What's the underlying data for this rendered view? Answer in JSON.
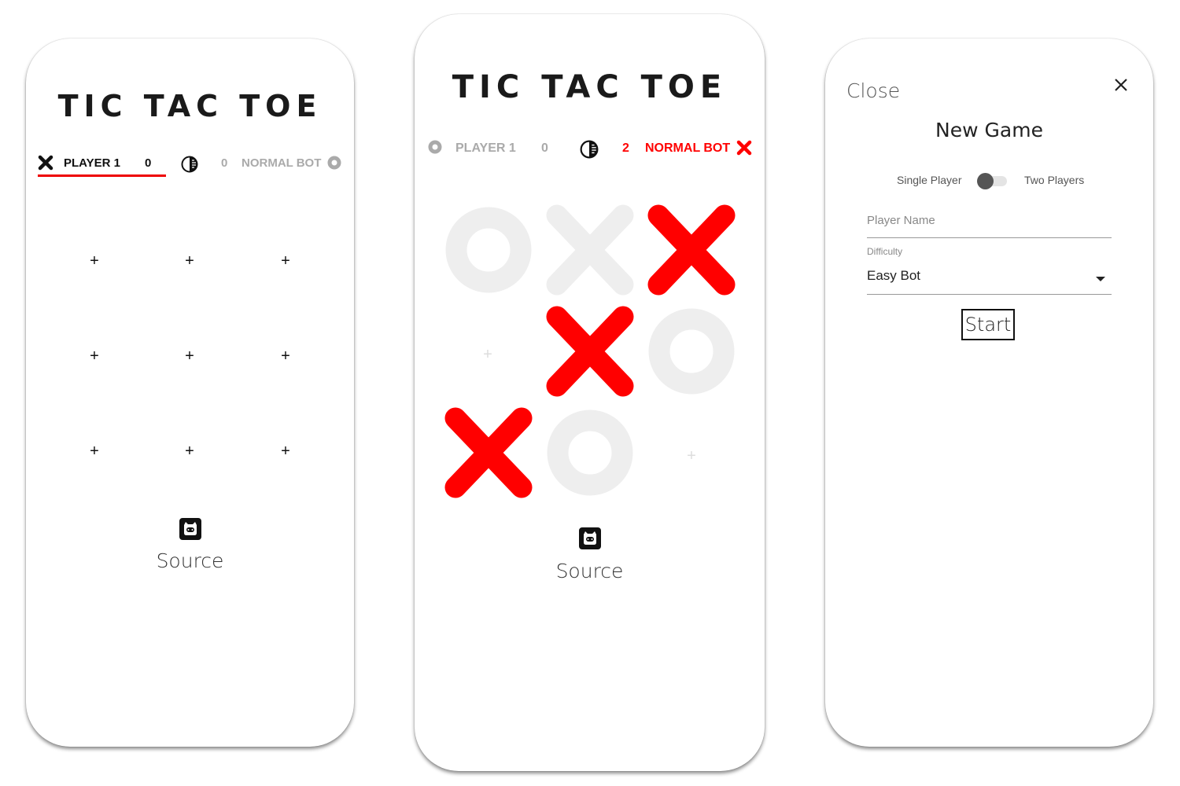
{
  "colors": {
    "accent": "#ff0000",
    "text": "#1a1a1a",
    "muted": "#aaaaaa",
    "ghost": "#eeeeee"
  },
  "left": {
    "title": "TIC TAC TOE",
    "player": {
      "mark": "x-icon",
      "name": "PLAYER 1",
      "score": "0"
    },
    "bot": {
      "mark": "o-icon",
      "name": "NORMAL BOT",
      "score": "0"
    },
    "theme_icon": "contrast-icon",
    "board": [
      "+",
      "+",
      "+",
      "+",
      "+",
      "+",
      "+",
      "+",
      "+"
    ],
    "source_label": "Source"
  },
  "middle": {
    "title": "TIC TAC TOE",
    "player": {
      "mark": "o-icon",
      "name": "PLAYER 1",
      "score": "0"
    },
    "bot": {
      "mark": "x-icon",
      "name": "NORMAL BOT",
      "score": "2"
    },
    "theme_icon": "contrast-icon",
    "board": [
      "O",
      "X",
      "X",
      "+",
      "X",
      "O",
      "X",
      "O",
      "+"
    ],
    "source_label": "Source"
  },
  "right": {
    "close_label": "Close",
    "title": "New Game",
    "mode_left": "Single Player",
    "mode_right": "Two Players",
    "name_placeholder": "Player Name",
    "difficulty_label": "Difficulty",
    "difficulty_value": "Easy Bot",
    "start_label": "Start"
  }
}
